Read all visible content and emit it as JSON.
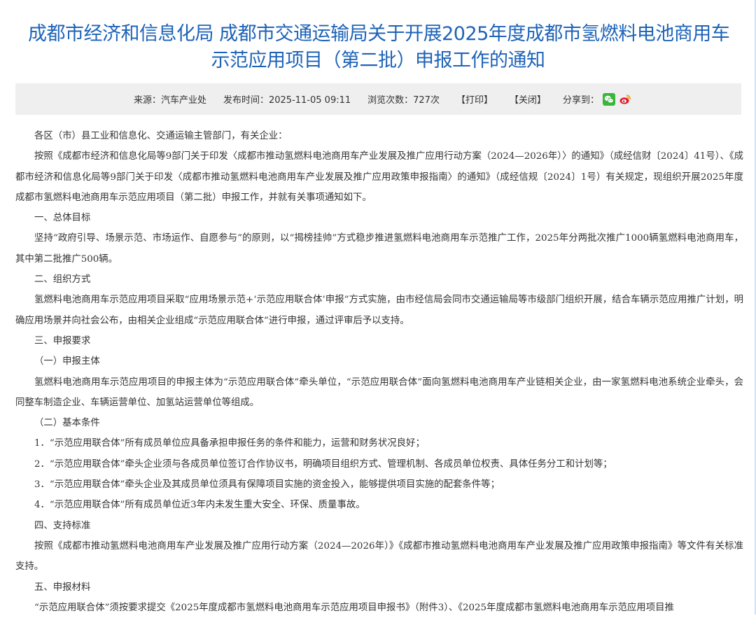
{
  "article": {
    "title_line1": "成都市经济和信息化局 成都市交通运输局关于开展2025年度成都市氢燃料电池商用车",
    "title_line2": "示范应用项目（第二批）申报工作的通知"
  },
  "meta": {
    "source": "来源：汽车产业处",
    "publish_time": "发布时间：2025-11-05 09:11",
    "views": "浏览次数：727次",
    "print_label": "【打印】",
    "close_label": "【关闭】",
    "share_label": "分享到："
  },
  "icons": {
    "wechat": "wechat-icon",
    "weibo": "weibo-icon"
  },
  "colors": {
    "title": "#1d63b8",
    "meta_bg": "#efefef",
    "wechat": "#3bb53b",
    "weibo": "#e6162d"
  },
  "body": {
    "paragraphs": [
      "各区（市）县工业和信息化、交通运输主管部门，有关企业：",
      "按照《成都市经济和信息化局等9部门关于印发〈成都市推动氢燃料电池商用车产业发展及推广应用行动方案（2024—2026年）〉的通知》（成经信财〔2024〕41号）、《成都市经济和信息化局等9部门关于印发〈成都市推动氢燃料电池商用车产业发展及推广应用政策申报指南〉的通知》（成经信规〔2024〕1号）有关规定，现组织开展2025年度成都市氢燃料电池商用车示范应用项目（第二批）申报工作，并就有关事项通知如下。",
      "一、总体目标",
      "坚持“政府引导、场景示范、市场运作、自愿参与”的原则，以“揭榜挂帅”方式稳步推进氢燃料电池商用车示范推广工作，2025年分两批次推广1000辆氢燃料电池商用车，其中第二批推广500辆。",
      "二、组织方式",
      "氢燃料电池商用车示范应用项目采取“应用场景示范+‘示范应用联合体’申报”方式实施，由市经信局会同市交通运输局等市级部门组织开展，结合车辆示范应用推广计划，明确应用场景并向社会公布，由相关企业组成“示范应用联合体”进行申报，通过评审后予以支持。",
      "三、申报要求",
      "（一）申报主体",
      "氢燃料电池商用车示范应用项目的申报主体为“示范应用联合体”牵头单位，“示范应用联合体”面向氢燃料电池商用车产业链相关企业，由一家氢燃料电池系统企业牵头，会同整车制造企业、车辆运营单位、加氢站运营单位等组成。",
      "（二）基本条件",
      "1．“示范应用联合体”所有成员单位应具备承担申报任务的条件和能力，运营和财务状况良好；",
      "2．“示范应用联合体”牵头企业须与各成员单位签订合作协议书，明确项目组织方式、管理机制、各成员单位权责、具体任务分工和计划等；",
      "3．“示范应用联合体”牵头企业及其成员单位须具有保障项目实施的资金投入，能够提供项目实施的配套条件等；",
      "4．“示范应用联合体”所有成员单位近3年内未发生重大安全、环保、质量事故。",
      "四、支持标准",
      "按照《成都市推动氢燃料电池商用车产业发展及推广应用行动方案（2024—2026年）》《成都市推动氢燃料电池商用车产业发展及推广应用政策申报指南》等文件有关标准支持。",
      "五、申报材料",
      "“示范应用联合体”须按要求提交《2025年度成都市氢燃料电池商用车示范应用项目申报书》（附件3）、《2025年度成都市氢燃料电池商用车示范应用项目推"
    ]
  }
}
